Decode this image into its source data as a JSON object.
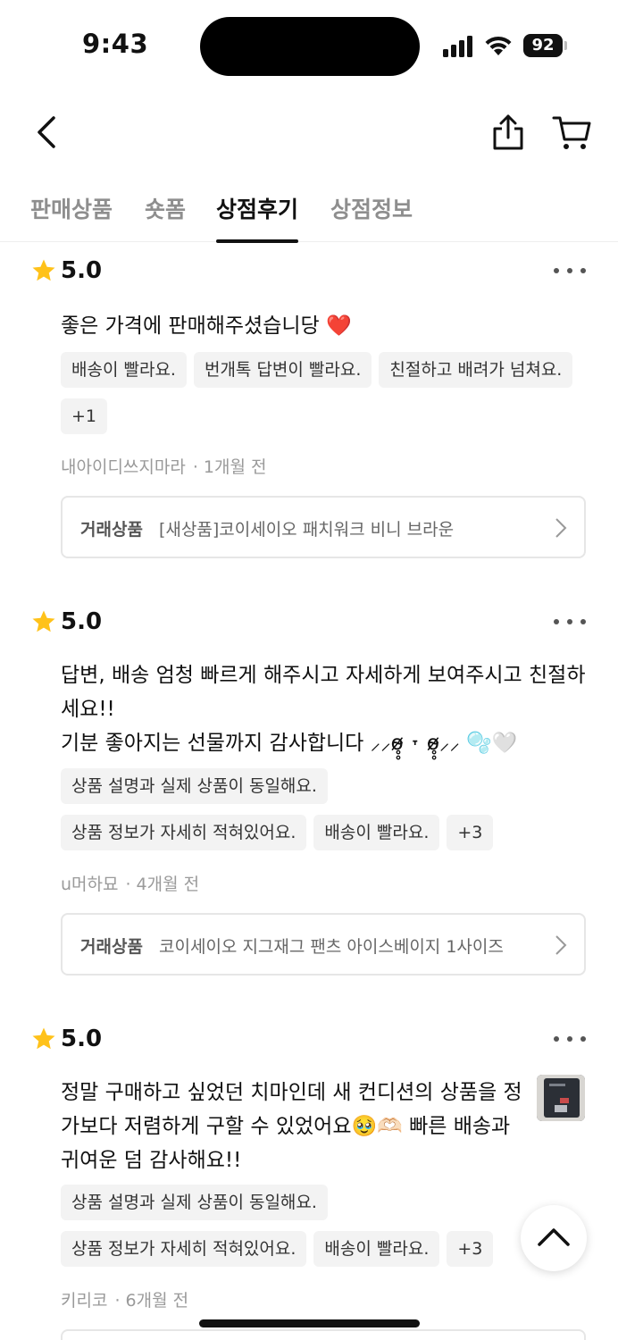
{
  "status_bar": {
    "time": "9:43",
    "battery": "92"
  },
  "header": {
    "back_icon": "chevron-left-icon",
    "share_icon": "share-icon",
    "cart_icon": "cart-icon"
  },
  "tabs": [
    {
      "label": "판매상품",
      "active": false
    },
    {
      "label": "숏폼",
      "active": false
    },
    {
      "label": "상점후기",
      "active": true
    },
    {
      "label": "상점정보",
      "active": false
    }
  ],
  "reviews": [
    {
      "rating": "5.0",
      "text": "좋은 가격에 판매해주셨습니당 ❤️",
      "tags": [
        "배송이 빨라요.",
        "번개톡 답변이 빨라요.",
        "친절하고 배려가 넘쳐요.",
        "+1"
      ],
      "author": "내아이디쓰지마라",
      "time": "1개월 전",
      "product_label": "거래상품",
      "product_name": "[새상품]코이세이오 패치워크 비니 브라운"
    },
    {
      "rating": "5.0",
      "text": "답변, 배송 엄청 빠르게 해주시고 자세하게 보여주시고 친절하\n세요!!\n기분 좋아지는 선물까지 감사합니다 ⸝⸝ø̴̷̥̥ ˕ ø̴̷̥̥⸝⸝ 🫧🤍",
      "tags": [
        "상품 설명과 실제 상품이 동일해요.",
        "상품 정보가 자세히 적혀있어요.",
        "배송이 빨라요.",
        "+3"
      ],
      "author": "u머하묘",
      "time": "4개월 전",
      "product_label": "거래상품",
      "product_name": "코이세이오 지그재그 팬츠 아이스베이지 1사이즈"
    },
    {
      "rating": "5.0",
      "text": "정말 구매하고 싶었던 치마인데 새 컨디션의 상품을 정\n가보다 저렴하게 구할 수 있었어요🥹🫶🏻 빠른 배송과\n귀여운 덤 감사해요!!",
      "tags": [
        "상품 설명과 실제 상품이 동일해요.",
        "상품 정보가 자세히 적혀있어요.",
        "배송이 빨라요.",
        "+3"
      ],
      "author": "키리코",
      "time": "6개월 전"
    }
  ],
  "scroll_top_icon": "chevron-up-icon",
  "colors": {
    "star": "#FFC21A",
    "tag_bg": "#F3F3F3",
    "muted_text": "#9A9A9A",
    "heart": "#D9162B"
  }
}
